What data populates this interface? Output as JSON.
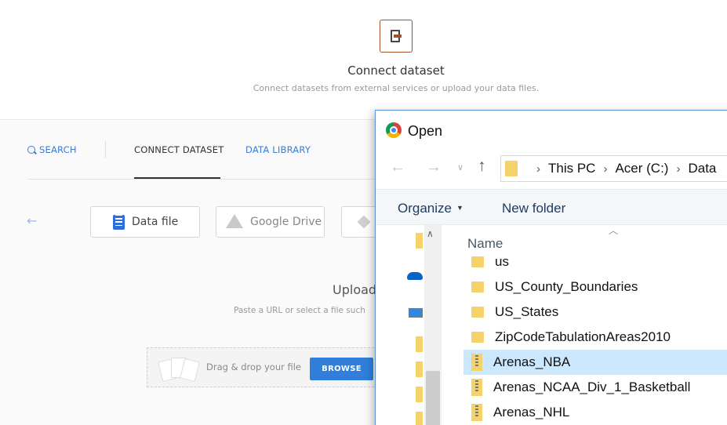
{
  "header": {
    "title": "Connect dataset",
    "subtitle": "Connect datasets from external services or upload your data files."
  },
  "nav": {
    "search": "SEARCH",
    "connect": "CONNECT DATASET",
    "library": "DATA LIBRARY"
  },
  "sources": {
    "data_file": "Data file",
    "google_drive": "Google Drive"
  },
  "upload": {
    "title": "Upload",
    "subtitle": "Paste a URL or select a file such",
    "drag_text": "Drag & drop your file",
    "browse": "BROWSE"
  },
  "dialog": {
    "title": "Open",
    "breadcrumb": [
      "This PC",
      "Acer (C:)",
      "Data"
    ],
    "organize": "Organize",
    "new_folder": "New folder",
    "column_name": "Name",
    "files": [
      {
        "name": "us",
        "type": "folder"
      },
      {
        "name": "US_County_Boundaries",
        "type": "folder"
      },
      {
        "name": "US_States",
        "type": "folder"
      },
      {
        "name": "ZipCodeTabulationAreas2010",
        "type": "folder"
      },
      {
        "name": "Arenas_NBA",
        "type": "zip",
        "selected": true
      },
      {
        "name": "Arenas_NCAA_Div_1_Basketball",
        "type": "zip"
      },
      {
        "name": "Arenas_NHL",
        "type": "zip"
      }
    ]
  },
  "colors": {
    "accent": "#3a7bd5",
    "browse_button": "#2f7fdb",
    "selection": "#cce8ff",
    "folder": "#f6d26b"
  }
}
